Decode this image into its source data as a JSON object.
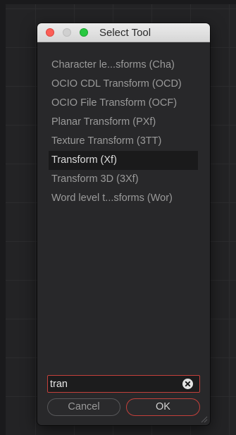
{
  "dialog": {
    "title": "Select Tool",
    "items": [
      {
        "label": "Character le...sforms (Cha)",
        "selected": false
      },
      {
        "label": "OCIO CDL Transform (OCD)",
        "selected": false
      },
      {
        "label": "OCIO File Transform (OCF)",
        "selected": false
      },
      {
        "label": "Planar Transform (PXf)",
        "selected": false
      },
      {
        "label": "Texture Transform (3TT)",
        "selected": false
      },
      {
        "label": "Transform (Xf)",
        "selected": true
      },
      {
        "label": "Transform 3D (3Xf)",
        "selected": false
      },
      {
        "label": "Word level t...sforms (Wor)",
        "selected": false
      }
    ],
    "search": {
      "value": "tran",
      "clear_icon": "clear-icon"
    },
    "buttons": {
      "cancel": "Cancel",
      "ok": "OK"
    }
  },
  "colors": {
    "accent": "#c3403b",
    "selected_row": "#1a1a1b",
    "close": "#fc5f57",
    "zoom": "#28c840"
  }
}
